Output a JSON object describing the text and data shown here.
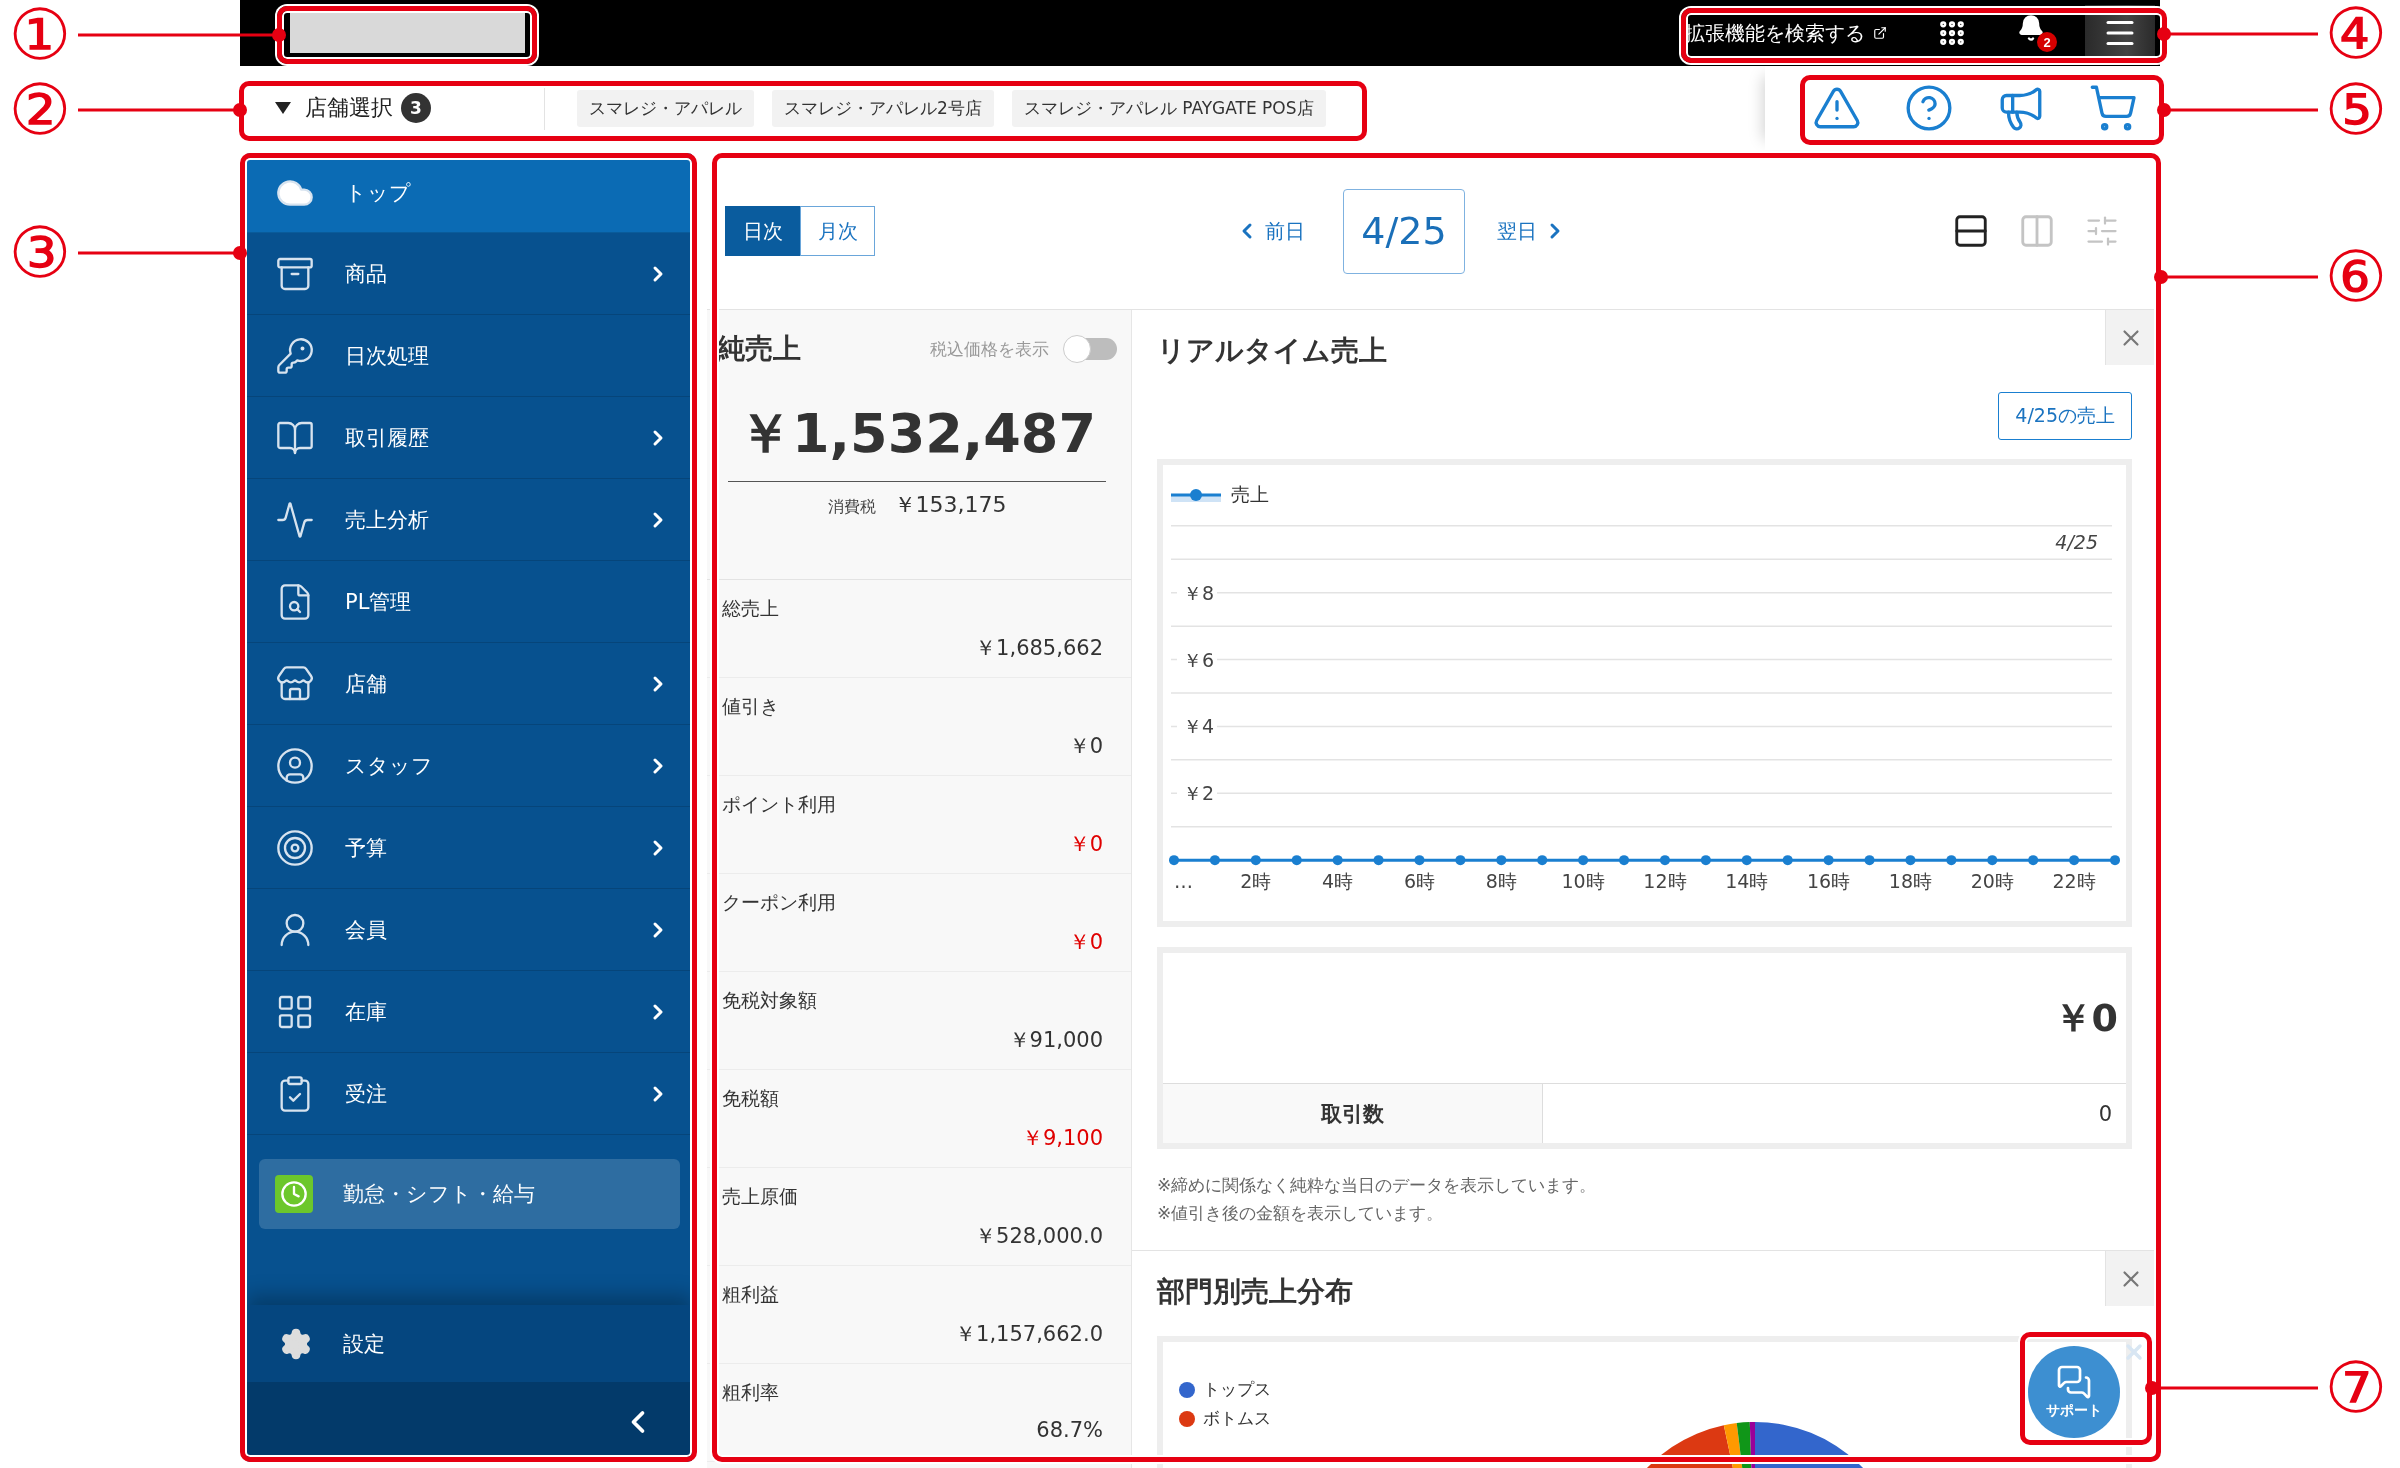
{
  "annotations": [
    {
      "label": "①"
    },
    {
      "label": "②"
    },
    {
      "label": "③"
    },
    {
      "label": "④"
    },
    {
      "label": "⑤"
    },
    {
      "label": "⑥"
    },
    {
      "label": "⑦"
    }
  ],
  "top_bar": {
    "search_link": "拡張機能を検索する",
    "notification_count": "2"
  },
  "store_bar": {
    "label": "店舗選択",
    "count": "3",
    "stores": [
      {
        "name": "スマレジ・アパレル"
      },
      {
        "name": "スマレジ・アパレル2号店"
      },
      {
        "name": "スマレジ・アパレル PAYGATE POS店"
      }
    ]
  },
  "sidebar": {
    "items": [
      {
        "label": "トップ",
        "selected": true,
        "has_submenu": false
      },
      {
        "label": "商品",
        "selected": false,
        "has_submenu": true
      },
      {
        "label": "日次処理",
        "selected": false,
        "has_submenu": false
      },
      {
        "label": "取引履歴",
        "selected": false,
        "has_submenu": true
      },
      {
        "label": "売上分析",
        "selected": false,
        "has_submenu": true
      },
      {
        "label": "PL管理",
        "selected": false,
        "has_submenu": false
      },
      {
        "label": "店舗",
        "selected": false,
        "has_submenu": true
      },
      {
        "label": "スタッフ",
        "selected": false,
        "has_submenu": true
      },
      {
        "label": "予算",
        "selected": false,
        "has_submenu": true
      },
      {
        "label": "会員",
        "selected": false,
        "has_submenu": true
      },
      {
        "label": "在庫",
        "selected": false,
        "has_submenu": true
      },
      {
        "label": "受注",
        "selected": false,
        "has_submenu": true
      }
    ],
    "featured": {
      "label": "勤怠・シフト・給与"
    },
    "settings": {
      "label": "設定"
    }
  },
  "toolbar": {
    "period_tabs": [
      {
        "label": "日次",
        "selected": true
      },
      {
        "label": "月次",
        "selected": false
      }
    ],
    "prev": "前日",
    "date": "4/25",
    "next": "翌日",
    "view_buttons": [
      {
        "selected": true
      },
      {
        "selected": false
      }
    ]
  },
  "net_sales": {
    "title": "純売上",
    "tax_toggle": {
      "label": "税込価格を表示",
      "on": false
    },
    "amount": "￥1,532,487",
    "tax_label": "消費税",
    "tax_amount": "￥153,175",
    "rows": [
      {
        "label": "総売上",
        "value": "￥1,685,662",
        "deduction": false
      },
      {
        "label": "値引き",
        "value": "￥0",
        "deduction": false
      },
      {
        "label": "ポイント利用",
        "value": "￥0",
        "deduction": true
      },
      {
        "label": "クーポン利用",
        "value": "￥0",
        "deduction": true
      },
      {
        "label": "免税対象額",
        "value": "￥91,000",
        "deduction": false
      },
      {
        "label": "免税額",
        "value": "￥9,100",
        "deduction": true
      },
      {
        "label": "売上原価",
        "value": "￥528,000.0",
        "deduction": false
      },
      {
        "label": "粗利益",
        "value": "￥1,157,662.0",
        "deduction": false
      },
      {
        "label": "粗利率",
        "value": "68.7%",
        "deduction": false
      }
    ]
  },
  "realtime": {
    "title": "リアルタイム売上",
    "date_button": "4/25の売上",
    "chart_data": {
      "type": "line",
      "x": [
        0,
        1,
        2,
        3,
        4,
        5,
        6,
        7,
        8,
        9,
        10,
        11,
        12,
        13,
        14,
        15,
        16,
        17,
        18,
        19,
        20,
        21,
        22,
        23
      ],
      "series": [
        {
          "name": "売上",
          "color": "#1a7fd0",
          "marker": "circle",
          "values": [
            0,
            0,
            0,
            0,
            0,
            0,
            0,
            0,
            0,
            0,
            0,
            0,
            0,
            0,
            0,
            0,
            0,
            0,
            0,
            0,
            0,
            0,
            0,
            0
          ]
        }
      ],
      "xlim": [
        0,
        23
      ],
      "ylim": [
        -2,
        12
      ],
      "grid": true,
      "yticks": [
        {
          "value": 2,
          "label": "￥2"
        },
        {
          "value": 4,
          "label": "￥4"
        },
        {
          "value": 6,
          "label": "￥6"
        },
        {
          "value": 8,
          "label": "￥8"
        }
      ],
      "xticks": [
        {
          "value": 0,
          "label": "…"
        },
        {
          "value": 2,
          "label": "2時"
        },
        {
          "value": 4,
          "label": "4時"
        },
        {
          "value": 6,
          "label": "6時"
        },
        {
          "value": 8,
          "label": "8時"
        },
        {
          "value": 10,
          "label": "10時"
        },
        {
          "value": 12,
          "label": "12時"
        },
        {
          "value": 14,
          "label": "14時"
        },
        {
          "value": 16,
          "label": "16時"
        },
        {
          "value": 18,
          "label": "18時"
        },
        {
          "value": 20,
          "label": "20時"
        },
        {
          "value": 22,
          "label": "22時"
        }
      ],
      "annotations": [
        {
          "text": "4/25"
        }
      ]
    },
    "total": "￥0",
    "stats": [
      {
        "label": "取引数",
        "value": "0"
      }
    ],
    "notes": [
      "※締めに関係なく純粋な当日のデータを表示しています。",
      "※値引き後の金額を表示しています。"
    ]
  },
  "department": {
    "title": "部門別売上分布",
    "legend": [
      {
        "label": "トップス",
        "color": "#3366cc"
      },
      {
        "label": "ボトムス",
        "color": "#dc3912"
      }
    ]
  },
  "support": {
    "label": "サポート"
  }
}
